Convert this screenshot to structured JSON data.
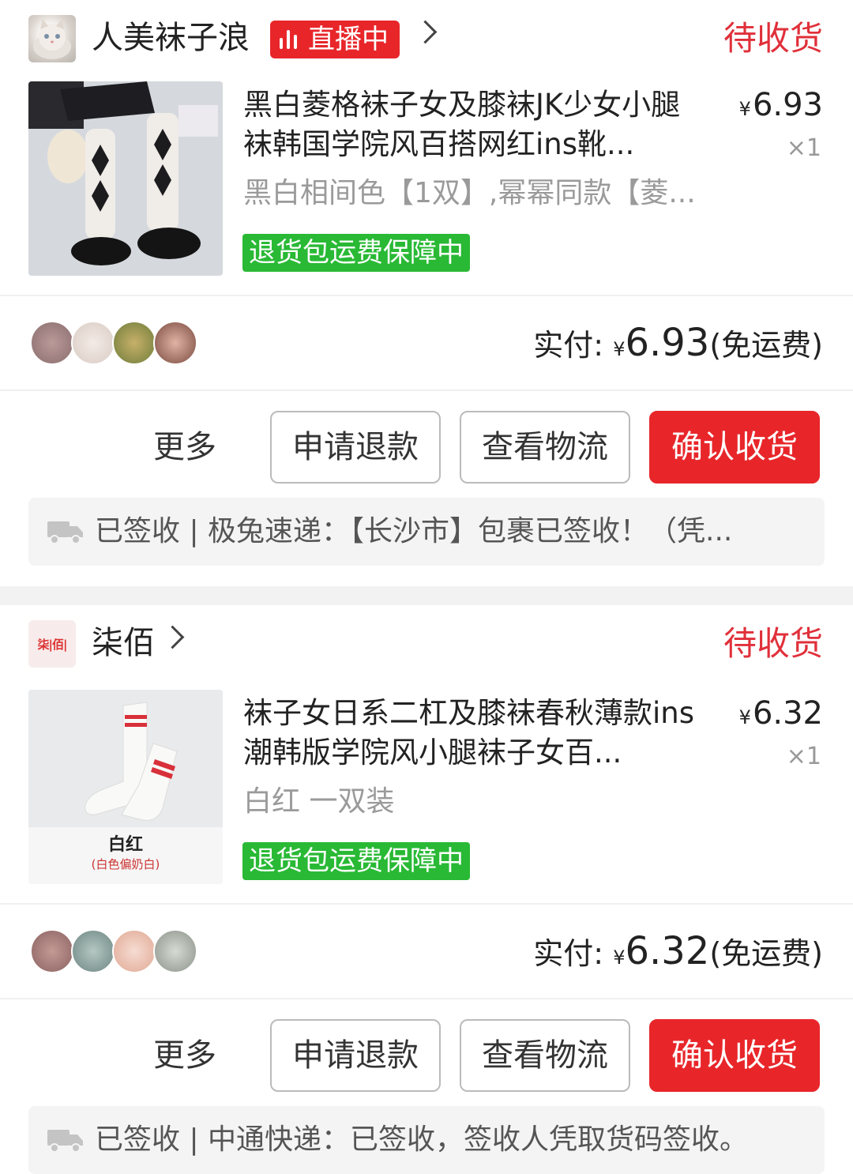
{
  "orders": [
    {
      "shop": {
        "name": "人美袜子浪",
        "live_badge": "直播中",
        "avatar_icon": "cat-avatar"
      },
      "status": "待收货",
      "item": {
        "title": "黑白菱格袜子女及膝袜JK少女小腿袜韩国学院风百搭网红ins靴...",
        "variant": "黑白相间色【1双】,幂幂同款【菱...",
        "price_symbol": "¥",
        "price": "6.93",
        "qty": "×1",
        "guarantee": "退货包运费保障中"
      },
      "paid": {
        "label": "实付:",
        "symbol": "¥",
        "amount": "6.93",
        "note": "(免运费)"
      },
      "actions": {
        "more": "更多",
        "refund": "申请退款",
        "logistics": "查看物流",
        "confirm": "确认收货"
      },
      "logistics_text": "已签收 | 极兔速递：【长沙市】包裹已签收！（凭..."
    },
    {
      "shop": {
        "name": "柒佰",
        "avatar_text": "柒|佰|"
      },
      "status": "待收货",
      "item": {
        "title": "袜子女日系二杠及膝袜春秋薄款ins潮韩版学院风小腿袜子女百...",
        "variant": "白红 一双装",
        "price_symbol": "¥",
        "price": "6.32",
        "qty": "×1",
        "guarantee": "退货包运费保障中",
        "image_caption": "白红",
        "image_subcaption": "(白色偏奶白)"
      },
      "paid": {
        "label": "实付:",
        "symbol": "¥",
        "amount": "6.32",
        "note": "(免运费)"
      },
      "actions": {
        "more": "更多",
        "refund": "申请退款",
        "logistics": "查看物流",
        "confirm": "确认收货"
      },
      "logistics_text": "已签收 | 中通快递：已签收，签收人凭取货码签收。"
    }
  ],
  "colors": {
    "accent": "#e8262a",
    "status": "#e0303a",
    "guarantee": "#29b935"
  }
}
